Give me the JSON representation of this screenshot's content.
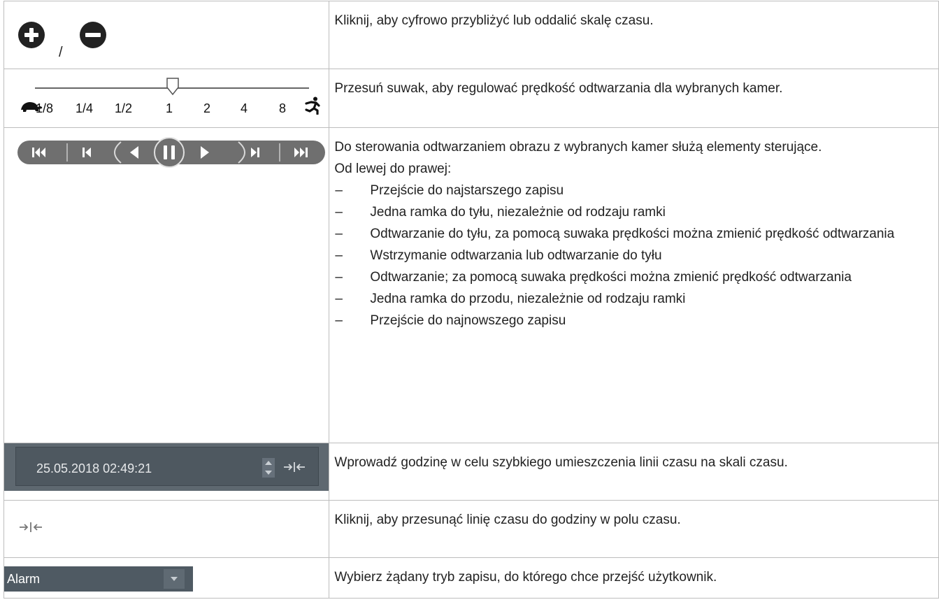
{
  "rows": [
    {
      "description": "Kliknij, aby cyfrowo przybliżyć lub oddalić skalę czasu."
    },
    {
      "description": "Przesuń suwak, aby regulować prędkość odtwarzania dla wybranych kamer."
    },
    {
      "description": "Do sterowania odtwarzaniem obrazu z wybranych kamer służą elementy sterujące.",
      "subheading": "Od lewej do prawej:",
      "items": [
        "Przejście do najstarszego zapisu",
        "Jedna ramka do tyłu, niezależnie od rodzaju ramki",
        "Odtwarzanie do tyłu, za pomocą suwaka prędkości można zmienić prędkość odtwarzania",
        "Wstrzymanie odtwarzania lub odtwarzanie do tyłu",
        "Odtwarzanie; za pomocą suwaka prędkości można zmienić prędkość odtwarzania",
        "Jedna ramka do przodu, niezależnie od rodzaju ramki",
        "Przejście do najnowszego zapisu"
      ]
    },
    {
      "description": "Wprowadź godzinę w celu szybkiego umieszczenia linii czasu na skali czasu."
    },
    {
      "description": "Kliknij, aby przesunąć linię czasu do godziny w polu czasu."
    },
    {
      "description": "Wybierz żądany tryb zapisu, do którego chce przejść użytkownik."
    }
  ],
  "zoom": {
    "separator": "/",
    "plus_icon": "zoom-in-icon",
    "minus_icon": "zoom-out-icon"
  },
  "speed": {
    "ticks": [
      "1/8",
      "1/4",
      "1/2",
      "1",
      "2",
      "4",
      "8"
    ],
    "slow_icon": "turtle-icon",
    "fast_icon": "runner-icon",
    "current_value": "1"
  },
  "transport": {
    "icons": [
      "skip-to-start-icon",
      "step-back-icon",
      "play-reverse-icon",
      "pause-icon",
      "play-icon",
      "step-forward-icon",
      "skip-to-end-icon"
    ],
    "bar_color": "#6f6f6f"
  },
  "time_field": {
    "value": "25.05.2018 02:49:21"
  },
  "dropdown": {
    "selected": "Alarm"
  },
  "dash": "–"
}
